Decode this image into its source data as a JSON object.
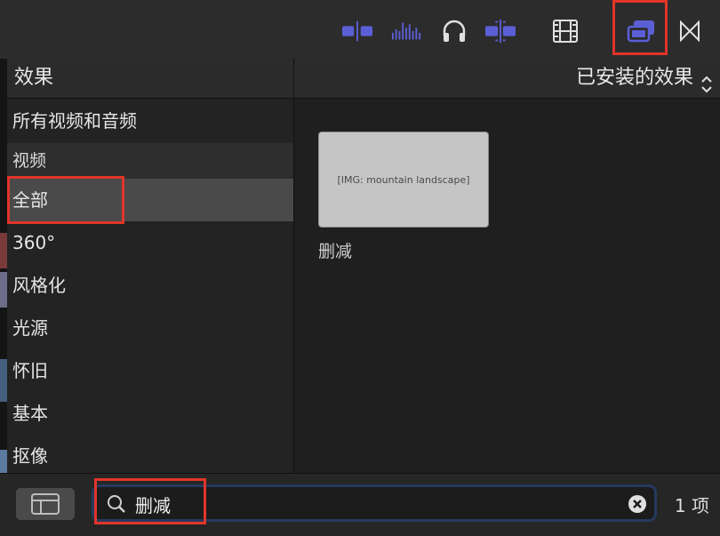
{
  "toolbar": {
    "icons": [
      "split-audio-icon",
      "waveform-icon",
      "headphones-icon",
      "skimming-icon",
      "filmstrip-icon",
      "effects-browser-icon",
      "transitions-icon"
    ],
    "accent": "#5b5fd6"
  },
  "sidebar": {
    "title": "效果",
    "items": [
      {
        "label": "所有视频和音频",
        "kind": "item"
      },
      {
        "label": "视频",
        "kind": "section"
      },
      {
        "label": "全部",
        "kind": "item",
        "selected": true
      },
      {
        "label": "360°",
        "kind": "item"
      },
      {
        "label": "风格化",
        "kind": "item"
      },
      {
        "label": "光源",
        "kind": "item"
      },
      {
        "label": "怀旧",
        "kind": "item"
      },
      {
        "label": "基本",
        "kind": "item"
      },
      {
        "label": "抠像",
        "kind": "item"
      }
    ]
  },
  "main": {
    "filter_label": "已安装的效果",
    "results": [
      {
        "label": "删减",
        "thumbnail": "mountain-landscape"
      }
    ]
  },
  "search": {
    "value": "删减",
    "placeholder": "",
    "result_count": "1 项"
  },
  "highlight_color": "#e2352a"
}
